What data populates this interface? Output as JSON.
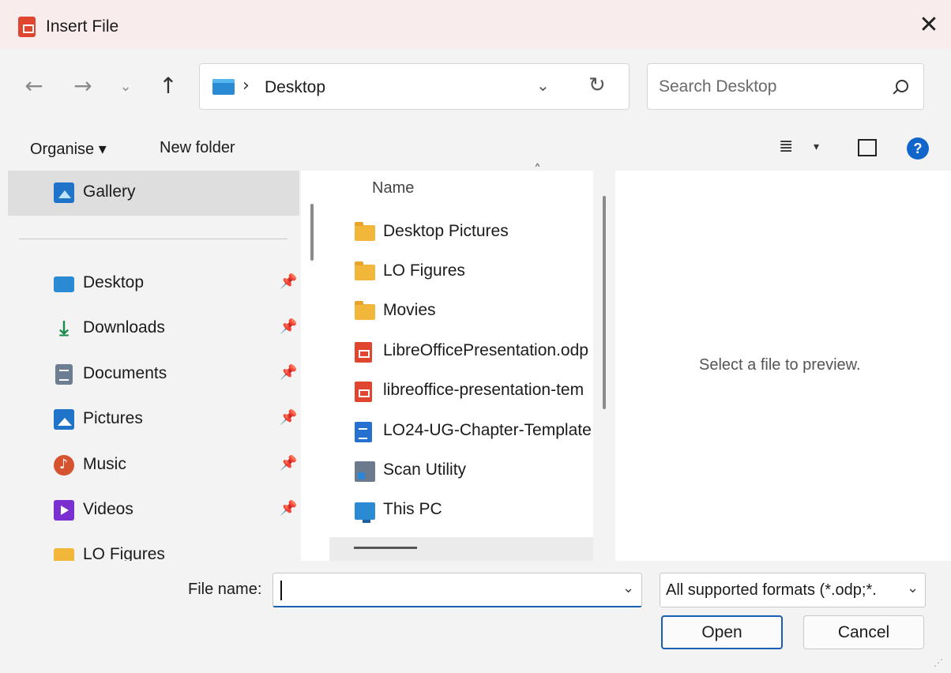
{
  "window": {
    "title": "Insert File",
    "close_glyph": "✕"
  },
  "navigation": {
    "back_glyph": "←",
    "forward_glyph": "→",
    "recent_glyph": "⌄",
    "up_glyph": "↑",
    "breadcrumb_separator": "›",
    "breadcrumb": [
      "Desktop"
    ],
    "address_dropdown_glyph": "⌄",
    "refresh_glyph": "↻"
  },
  "search": {
    "placeholder": "Search Desktop",
    "value": ""
  },
  "toolbar": {
    "organise_label": "Organise ▾",
    "new_folder_label": "New folder",
    "view_glyph": "≣",
    "view_dropdown_glyph": "▾",
    "help_label": "?"
  },
  "sidebar": {
    "pin_glyph": "📌",
    "items": [
      {
        "label": "Gallery",
        "icon": "gallery-icon",
        "pinned": false,
        "selected": true
      },
      {
        "label": "Desktop",
        "icon": "desktop-folder-icon",
        "pinned": true
      },
      {
        "label": "Downloads",
        "icon": "download-arrow-icon",
        "download_glyph": "⤓",
        "pinned": true
      },
      {
        "label": "Documents",
        "icon": "documents-icon",
        "pinned": true
      },
      {
        "label": "Pictures",
        "icon": "pictures-icon",
        "pinned": true
      },
      {
        "label": "Music",
        "icon": "music-icon",
        "pinned": true
      },
      {
        "label": "Videos",
        "icon": "videos-icon",
        "pinned": true
      },
      {
        "label": "LO Figures",
        "icon": "folder-icon",
        "pinned": false
      }
    ]
  },
  "file_list": {
    "sort_caret": "˄",
    "column_header": "Name",
    "files": [
      {
        "name": "Desktop Pictures",
        "icon": "folder-icon"
      },
      {
        "name": "LO Figures",
        "icon": "folder-icon"
      },
      {
        "name": "Movies",
        "icon": "folder-icon"
      },
      {
        "name": "LibreOfficePresentation.odp",
        "icon": "impress-file-icon"
      },
      {
        "name": "libreoffice-presentation-tem",
        "icon": "impress-file-icon"
      },
      {
        "name": "LO24-UG-Chapter-Template",
        "icon": "writer-file-icon"
      },
      {
        "name": "Scan Utility",
        "icon": "app-shortcut-icon"
      },
      {
        "name": "This PC",
        "icon": "this-pc-icon"
      }
    ]
  },
  "preview": {
    "message": "Select a file to preview."
  },
  "footer": {
    "file_name_label": "File name:",
    "file_name_value": "",
    "file_name_dropdown_glyph": "⌄",
    "filter_value": "All supported formats (*.odp;*.",
    "filter_dropdown_glyph": "⌄",
    "open_label": "Open",
    "cancel_label": "Cancel",
    "resize_grip_glyph": "⋰"
  },
  "colors": {
    "accent": "#1a5fb4",
    "titlebar_bg": "#f8ecec",
    "app_icon": "#e0452f",
    "folder": "#f2b63a",
    "help_icon": "#1166cc"
  }
}
